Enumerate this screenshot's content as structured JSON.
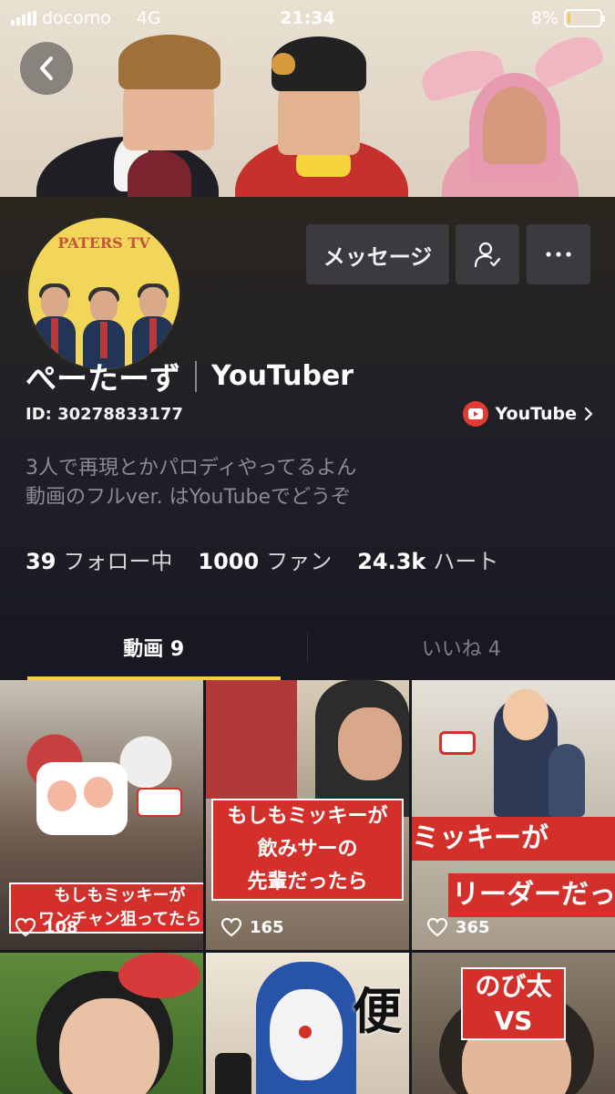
{
  "status_bar": {
    "carrier": "docomo",
    "network": "4G",
    "time": "21:34",
    "battery_percent": "8%",
    "battery_level": 0.08
  },
  "header": {
    "back_icon": "chevron-left-icon"
  },
  "profile": {
    "avatar_text": "PATERS TV",
    "message_button": "メッセージ",
    "follow_icon": "user-check-icon",
    "more_icon": "ellipsis-icon",
    "name": "ぺーたーず",
    "role": "YouTuber",
    "id_text": "ID: 30278833177",
    "youtube_link": "YouTube",
    "bio_line1": "3人で再現とかパロディやってるよん",
    "bio_line2": "動画のフルver. はYouTubeでどうぞ",
    "stats": {
      "following_count": "39",
      "following_label": "フォロー中",
      "fans_count": "1000",
      "fans_label": "ファン",
      "hearts_count": "24.3k",
      "hearts_label": "ハート"
    }
  },
  "tabs": [
    {
      "label": "動画 9",
      "active": true
    },
    {
      "label": "いいね 4",
      "active": false
    }
  ],
  "videos": [
    {
      "caption_line1": "もしもミッキーが",
      "caption_line2": "ワンチャン狙ってたら",
      "likes": "108"
    },
    {
      "caption_line1": "もしもミッキーが",
      "caption_line2": "飲みサーの",
      "caption_line3": "先輩だったら",
      "likes": "165"
    },
    {
      "caption_line1": "ミッキーが",
      "caption_line2": "リーダーだっ",
      "likes": "365"
    },
    {
      "caption_line1": ""
    },
    {
      "caption_line1": "便"
    },
    {
      "caption_line1": "のび太",
      "caption_line2": "VS"
    }
  ],
  "colors": {
    "accent": "#f7c948",
    "caption_red": "#d4302b",
    "youtube_red": "#e23b35"
  }
}
